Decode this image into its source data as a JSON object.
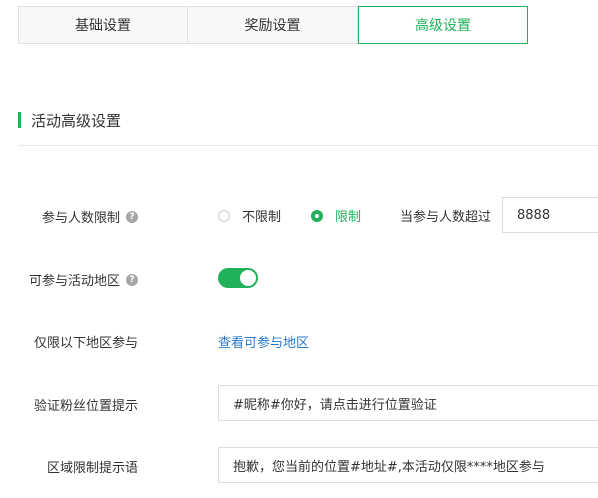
{
  "tabs": [
    {
      "label": "基础设置",
      "active": false
    },
    {
      "label": "奖励设置",
      "active": false
    },
    {
      "label": "高级设置",
      "active": true
    }
  ],
  "section": {
    "title": "活动高级设置"
  },
  "participant_limit": {
    "label": "参与人数限制",
    "options": [
      {
        "label": "不限制",
        "selected": false
      },
      {
        "label": "限制",
        "selected": true
      }
    ],
    "exceed_label": "当参与人数超过",
    "value": "8888"
  },
  "region": {
    "label": "可参与活动地区",
    "enabled": true
  },
  "only_regions": {
    "label": "仅限以下地区参与",
    "link_text": "查看可参与地区"
  },
  "verify_tip": {
    "label": "验证粉丝位置提示",
    "value": "#昵称#你好，请点击进行位置验证"
  },
  "region_limit_tip": {
    "label": "区域限制提示语",
    "value": "抱歉，您当前的位置#地址#,本活动仅限****地区参与"
  },
  "colors": {
    "accent": "#20b15a",
    "link": "#2a78c8"
  }
}
